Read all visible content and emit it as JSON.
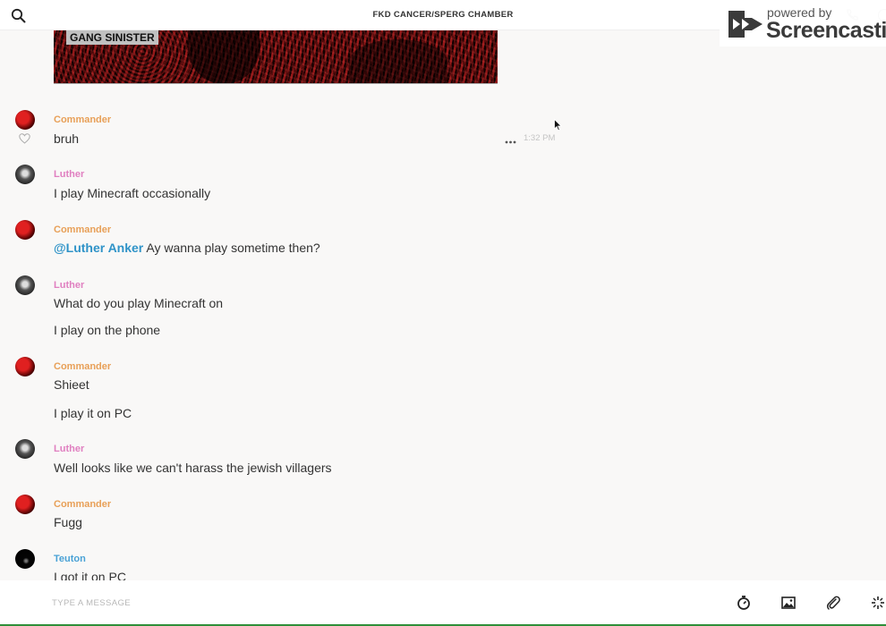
{
  "header": {
    "title": "FKD CANCER/SPERG CHAMBER"
  },
  "watermark": {
    "powered_by": "powered by",
    "brand": "Screencastify"
  },
  "shared_image": {
    "caption": "GANG SINISTER"
  },
  "messages": [
    {
      "author": "Commander",
      "text": "bruh",
      "time": "1:32 PM"
    },
    {
      "author": "Luther",
      "text": "I play Minecraft occasionally"
    },
    {
      "author": "Commander",
      "mention": "@Luther Anker",
      "text": " Ay wanna play sometime then?"
    },
    {
      "author": "Luther",
      "text": "What do you play Minecraft on",
      "text2": "I play on the phone"
    },
    {
      "author": "Commander",
      "text": "Shieet",
      "text2": "I play it on PC"
    },
    {
      "author": "Luther",
      "text": "Well looks like we can't harass the jewish villagers"
    },
    {
      "author": "Commander",
      "text": "Fugg"
    },
    {
      "author": "Teuton",
      "text": "I got it on PC"
    }
  ],
  "composer": {
    "placeholder": "TYPE A MESSAGE"
  },
  "colors": {
    "commander": "#e8a058",
    "luther": "#e07fc0",
    "teuton": "#4aa2d6",
    "mention": "#2f93c8"
  },
  "icons": {
    "search": "search-icon",
    "phone": "phone-icon",
    "info": "info-icon",
    "like": "heart-icon",
    "more": "more-icon",
    "timer": "stopwatch-icon",
    "image": "image-icon",
    "attach": "paperclip-icon",
    "giphy": "sparkle-icon"
  }
}
